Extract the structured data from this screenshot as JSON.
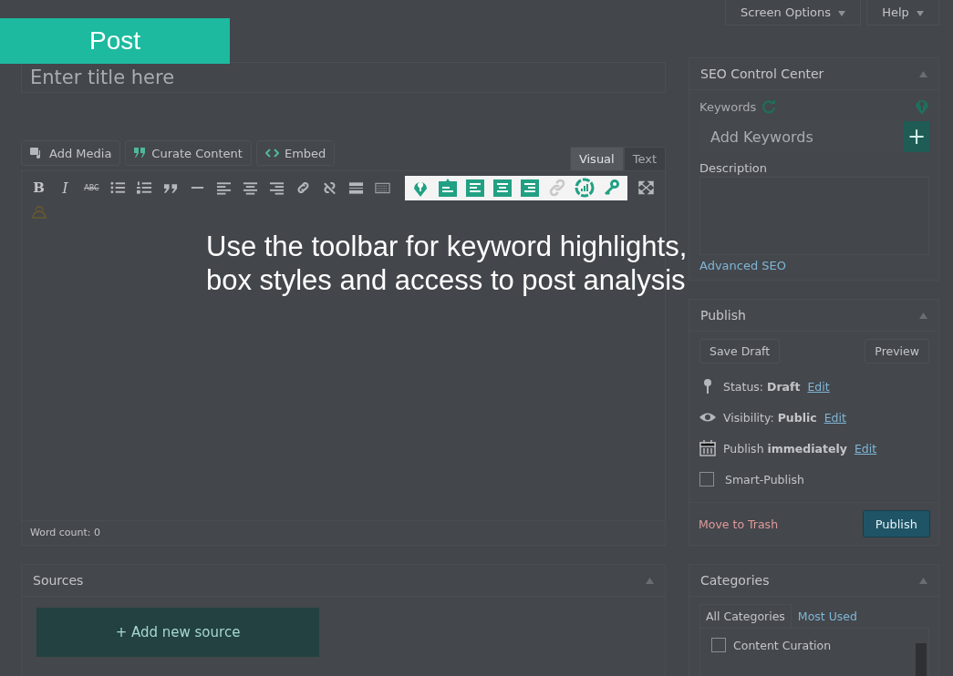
{
  "header_tabs": [
    {
      "label": "Screen Options"
    },
    {
      "label": "Help"
    }
  ],
  "banner": {
    "label": "Post"
  },
  "title_field": {
    "placeholder": "Enter title here"
  },
  "media_buttons": [
    {
      "kind": "media",
      "label": "Add Media"
    },
    {
      "kind": "curate",
      "label": "Curate Content"
    },
    {
      "kind": "embed",
      "label": "Embed"
    }
  ],
  "editor_tabs": [
    {
      "label": "Visual",
      "selected": true
    },
    {
      "label": "Text",
      "selected": false
    }
  ],
  "toolbar": [
    {
      "kind": "bold",
      "glyph": "B"
    },
    {
      "kind": "italic",
      "glyph": "I"
    },
    {
      "kind": "strike",
      "glyph": "ABC"
    },
    {
      "kind": "bullets"
    },
    {
      "kind": "numbers"
    },
    {
      "kind": "quote"
    },
    {
      "kind": "hr"
    },
    {
      "kind": "left"
    },
    {
      "kind": "center"
    },
    {
      "kind": "right"
    },
    {
      "kind": "link"
    },
    {
      "kind": "unlink"
    },
    {
      "kind": "more"
    },
    {
      "kind": "keyboard"
    }
  ],
  "seo_toolbar": [
    {
      "kind": "pin"
    },
    {
      "kind": "note"
    },
    {
      "kind": "left"
    },
    {
      "kind": "center"
    },
    {
      "kind": "right"
    },
    {
      "kind": "link"
    },
    {
      "kind": "chart"
    },
    {
      "kind": "key"
    }
  ],
  "tutorial": {
    "lines": [
      "Use the toolbar for keyword highlights,",
      "box styles and access to post analysis"
    ]
  },
  "word_count": "Word count: 0",
  "sources": {
    "title": "Sources",
    "button": "+ Add new source"
  },
  "seo_panel": {
    "title": "SEO Control Center",
    "keywords_label": "Keywords",
    "keywords_field": {
      "placeholder": "Add Keywords"
    },
    "add_button": "+",
    "description_label": "Description",
    "advanced_link": "Advanced SEO"
  },
  "publish_panel": {
    "title": "Publish",
    "save_draft": "Save Draft",
    "preview": "Preview",
    "rows": [
      {
        "kind": "status",
        "text": "Status: **Draft**",
        "link": "Edit"
      },
      {
        "kind": "visibility",
        "text": "Visibility: **Public**",
        "link": "Edit"
      },
      {
        "kind": "schedule",
        "text": "Publish **immediately**",
        "link": "Edit"
      }
    ],
    "smart_publish": {
      "label": "Smart-Publish",
      "checked": false
    },
    "trash": "Move to Trash",
    "publish": "Publish"
  },
  "categories_panel": {
    "title": "Categories",
    "tabs": [
      {
        "label": "All Categories",
        "selected": true
      },
      {
        "label": "Most Used",
        "selected": false
      }
    ],
    "items": [
      {
        "label": "Content Curation",
        "checked": false
      }
    ]
  }
}
